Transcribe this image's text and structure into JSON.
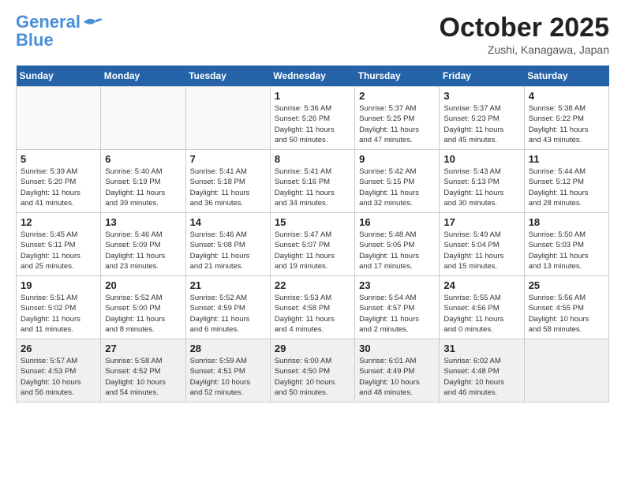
{
  "header": {
    "logo_line1": "General",
    "logo_line2": "Blue",
    "month": "October 2025",
    "location": "Zushi, Kanagawa, Japan"
  },
  "weekdays": [
    "Sunday",
    "Monday",
    "Tuesday",
    "Wednesday",
    "Thursday",
    "Friday",
    "Saturday"
  ],
  "weeks": [
    [
      {
        "day": "",
        "info": ""
      },
      {
        "day": "",
        "info": ""
      },
      {
        "day": "",
        "info": ""
      },
      {
        "day": "1",
        "info": "Sunrise: 5:36 AM\nSunset: 5:26 PM\nDaylight: 11 hours\nand 50 minutes."
      },
      {
        "day": "2",
        "info": "Sunrise: 5:37 AM\nSunset: 5:25 PM\nDaylight: 11 hours\nand 47 minutes."
      },
      {
        "day": "3",
        "info": "Sunrise: 5:37 AM\nSunset: 5:23 PM\nDaylight: 11 hours\nand 45 minutes."
      },
      {
        "day": "4",
        "info": "Sunrise: 5:38 AM\nSunset: 5:22 PM\nDaylight: 11 hours\nand 43 minutes."
      }
    ],
    [
      {
        "day": "5",
        "info": "Sunrise: 5:39 AM\nSunset: 5:20 PM\nDaylight: 11 hours\nand 41 minutes."
      },
      {
        "day": "6",
        "info": "Sunrise: 5:40 AM\nSunset: 5:19 PM\nDaylight: 11 hours\nand 39 minutes."
      },
      {
        "day": "7",
        "info": "Sunrise: 5:41 AM\nSunset: 5:18 PM\nDaylight: 11 hours\nand 36 minutes."
      },
      {
        "day": "8",
        "info": "Sunrise: 5:41 AM\nSunset: 5:16 PM\nDaylight: 11 hours\nand 34 minutes."
      },
      {
        "day": "9",
        "info": "Sunrise: 5:42 AM\nSunset: 5:15 PM\nDaylight: 11 hours\nand 32 minutes."
      },
      {
        "day": "10",
        "info": "Sunrise: 5:43 AM\nSunset: 5:13 PM\nDaylight: 11 hours\nand 30 minutes."
      },
      {
        "day": "11",
        "info": "Sunrise: 5:44 AM\nSunset: 5:12 PM\nDaylight: 11 hours\nand 28 minutes."
      }
    ],
    [
      {
        "day": "12",
        "info": "Sunrise: 5:45 AM\nSunset: 5:11 PM\nDaylight: 11 hours\nand 25 minutes."
      },
      {
        "day": "13",
        "info": "Sunrise: 5:46 AM\nSunset: 5:09 PM\nDaylight: 11 hours\nand 23 minutes."
      },
      {
        "day": "14",
        "info": "Sunrise: 5:46 AM\nSunset: 5:08 PM\nDaylight: 11 hours\nand 21 minutes."
      },
      {
        "day": "15",
        "info": "Sunrise: 5:47 AM\nSunset: 5:07 PM\nDaylight: 11 hours\nand 19 minutes."
      },
      {
        "day": "16",
        "info": "Sunrise: 5:48 AM\nSunset: 5:05 PM\nDaylight: 11 hours\nand 17 minutes."
      },
      {
        "day": "17",
        "info": "Sunrise: 5:49 AM\nSunset: 5:04 PM\nDaylight: 11 hours\nand 15 minutes."
      },
      {
        "day": "18",
        "info": "Sunrise: 5:50 AM\nSunset: 5:03 PM\nDaylight: 11 hours\nand 13 minutes."
      }
    ],
    [
      {
        "day": "19",
        "info": "Sunrise: 5:51 AM\nSunset: 5:02 PM\nDaylight: 11 hours\nand 11 minutes."
      },
      {
        "day": "20",
        "info": "Sunrise: 5:52 AM\nSunset: 5:00 PM\nDaylight: 11 hours\nand 8 minutes."
      },
      {
        "day": "21",
        "info": "Sunrise: 5:52 AM\nSunset: 4:59 PM\nDaylight: 11 hours\nand 6 minutes."
      },
      {
        "day": "22",
        "info": "Sunrise: 5:53 AM\nSunset: 4:58 PM\nDaylight: 11 hours\nand 4 minutes."
      },
      {
        "day": "23",
        "info": "Sunrise: 5:54 AM\nSunset: 4:57 PM\nDaylight: 11 hours\nand 2 minutes."
      },
      {
        "day": "24",
        "info": "Sunrise: 5:55 AM\nSunset: 4:56 PM\nDaylight: 11 hours\nand 0 minutes."
      },
      {
        "day": "25",
        "info": "Sunrise: 5:56 AM\nSunset: 4:55 PM\nDaylight: 10 hours\nand 58 minutes."
      }
    ],
    [
      {
        "day": "26",
        "info": "Sunrise: 5:57 AM\nSunset: 4:53 PM\nDaylight: 10 hours\nand 56 minutes."
      },
      {
        "day": "27",
        "info": "Sunrise: 5:58 AM\nSunset: 4:52 PM\nDaylight: 10 hours\nand 54 minutes."
      },
      {
        "day": "28",
        "info": "Sunrise: 5:59 AM\nSunset: 4:51 PM\nDaylight: 10 hours\nand 52 minutes."
      },
      {
        "day": "29",
        "info": "Sunrise: 6:00 AM\nSunset: 4:50 PM\nDaylight: 10 hours\nand 50 minutes."
      },
      {
        "day": "30",
        "info": "Sunrise: 6:01 AM\nSunset: 4:49 PM\nDaylight: 10 hours\nand 48 minutes."
      },
      {
        "day": "31",
        "info": "Sunrise: 6:02 AM\nSunset: 4:48 PM\nDaylight: 10 hours\nand 46 minutes."
      },
      {
        "day": "",
        "info": ""
      }
    ]
  ]
}
